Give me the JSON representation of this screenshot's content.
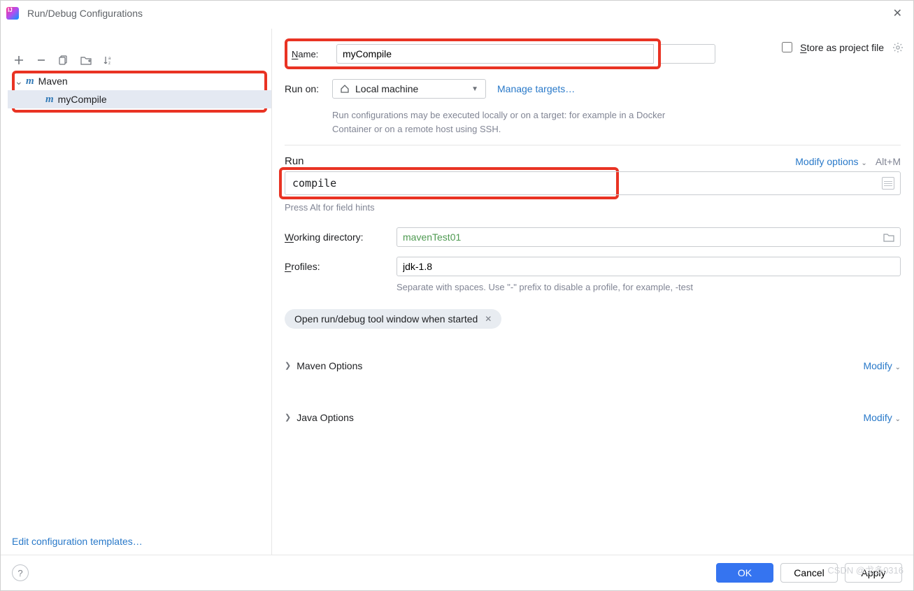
{
  "window": {
    "title": "Run/Debug Configurations"
  },
  "toolbar": {
    "add": "add-icon",
    "remove": "remove-icon",
    "copy": "copy-icon",
    "save": "save-icon",
    "sort": "sort-icon"
  },
  "tree": {
    "root": "Maven",
    "items": [
      {
        "label": "myCompile",
        "selected": true
      }
    ]
  },
  "sidebar": {
    "templates_link": "Edit configuration templates…"
  },
  "form": {
    "name_label": "Name:",
    "name_value": "myCompile",
    "store_label": "Store as project file",
    "run_on_label": "Run on:",
    "run_on_value": "Local machine",
    "manage_targets": "Manage targets…",
    "run_on_hint": "Run configurations may be executed locally or on a target: for example in a Docker Container or on a remote host using SSH.",
    "run_title": "Run",
    "modify_options": "Modify options",
    "modify_shortcut": "Alt+M",
    "run_cmd": "compile",
    "run_hint": "Press Alt for field hints",
    "wd_label": "Working directory:",
    "wd_value": "mavenTest01",
    "profiles_label": "Profiles:",
    "profiles_value": "jdk-1.8",
    "profiles_hint": "Separate with spaces. Use \"-\" prefix to disable a profile, for example, -test",
    "chip": "Open run/debug tool window when started",
    "maven_options": "Maven Options",
    "java_options": "Java Options",
    "modify": "Modify"
  },
  "footer": {
    "ok": "OK",
    "cancel": "Cancel",
    "apply": "Apply"
  },
  "watermark": "CSDN @戈多0316"
}
